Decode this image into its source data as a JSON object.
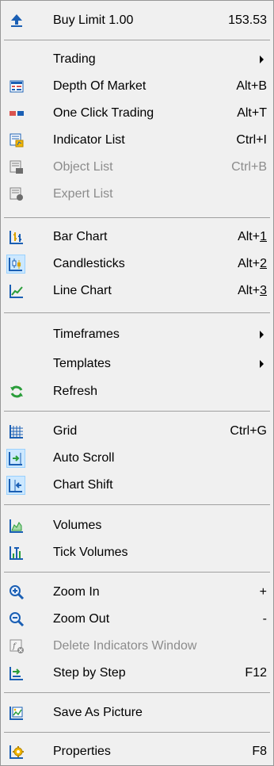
{
  "menu": {
    "buy_limit": {
      "label": "Buy Limit 1.00",
      "shortcut": "153.53"
    },
    "trading": {
      "label": "Trading"
    },
    "depth_of_market": {
      "label": "Depth Of Market",
      "shortcut": "Alt+B"
    },
    "one_click_trading": {
      "label": "One Click Trading",
      "shortcut": "Alt+T"
    },
    "indicator_list": {
      "label": "Indicator List",
      "shortcut": "Ctrl+I"
    },
    "object_list": {
      "label": "Object List",
      "shortcut": "Ctrl+B"
    },
    "expert_list": {
      "label": "Expert List"
    },
    "bar_chart": {
      "label": "Bar Chart",
      "shortcut_prefix": "Alt+",
      "shortcut_key": "1"
    },
    "candlesticks": {
      "label": "Candlesticks",
      "shortcut_prefix": "Alt+",
      "shortcut_key": "2"
    },
    "line_chart": {
      "label": "Line Chart",
      "shortcut_prefix": "Alt+",
      "shortcut_key": "3"
    },
    "timeframes": {
      "label": "Timeframes"
    },
    "templates": {
      "label": "Templates"
    },
    "refresh": {
      "label": "Refresh"
    },
    "grid": {
      "label": "Grid",
      "shortcut": "Ctrl+G"
    },
    "auto_scroll": {
      "label": "Auto Scroll"
    },
    "chart_shift": {
      "label": "Chart Shift"
    },
    "volumes": {
      "label": "Volumes"
    },
    "tick_volumes": {
      "label": "Tick Volumes"
    },
    "zoom_in": {
      "label": "Zoom In",
      "shortcut": "+"
    },
    "zoom_out": {
      "label": "Zoom Out",
      "shortcut": "-"
    },
    "delete_indicators_window": {
      "label": "Delete Indicators Window"
    },
    "step_by_step": {
      "label": "Step by Step",
      "shortcut": "F12"
    },
    "save_as_picture": {
      "label": "Save As Picture"
    },
    "properties": {
      "label": "Properties",
      "shortcut": "F8"
    }
  },
  "colors": {
    "menu_bg": "#f0f0f0",
    "separator": "#a0a0a0",
    "disabled_text": "#8c8c8c",
    "checked_bg": "#cce8ff",
    "icon_blue": "#1a5fb4",
    "icon_green": "#2a9d3a"
  }
}
